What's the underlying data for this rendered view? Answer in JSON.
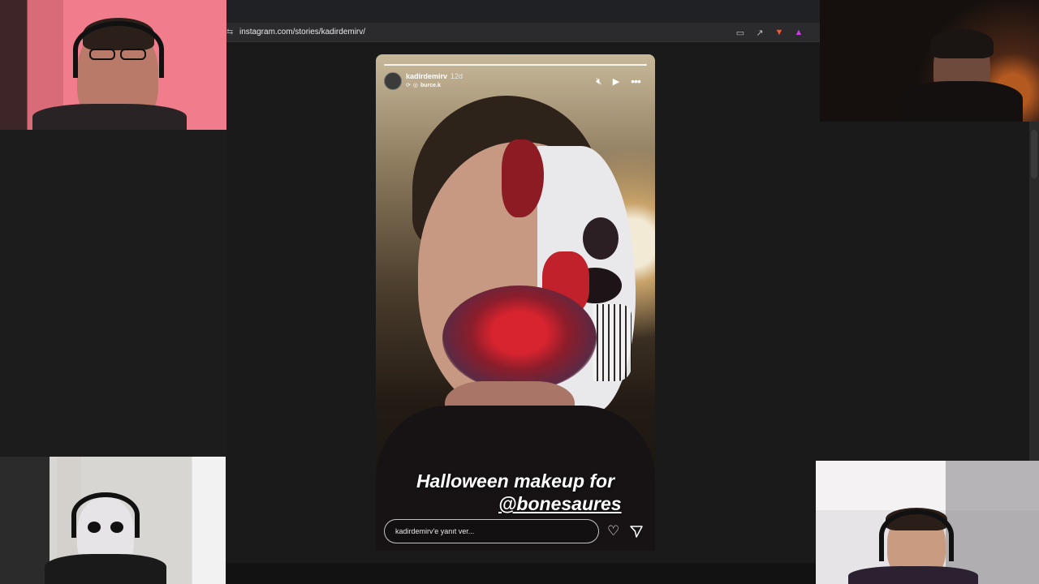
{
  "browser": {
    "url": "instagram.com/stories/kadirdemirv/",
    "actions": [
      "cast-icon",
      "share-icon",
      "brave-shield-icon",
      "brave-rewards-icon"
    ]
  },
  "story": {
    "username": "kadirdemirv",
    "time_ago": "12d",
    "reshared_from": "burce.k",
    "caption_line1": "Halloween makeup for",
    "caption_mention": "@bonesaures",
    "reply_placeholder": "kadirdemirv'e yanıt ver...",
    "progress": 1.0
  },
  "colors": {
    "page_bg": "#1a1a1a",
    "address_bar": "#2b2b2e",
    "text_primary": "#ffffff"
  }
}
